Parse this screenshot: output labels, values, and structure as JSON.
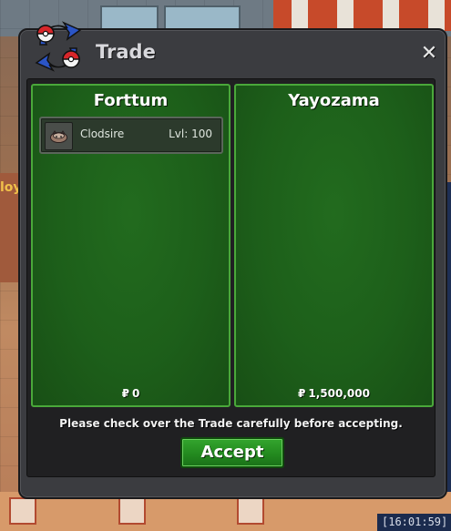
{
  "window": {
    "title": "Trade",
    "close_icon": "close-icon",
    "trade_icon": "pokeball-swap-icon"
  },
  "left_panel": {
    "player": "Forttum",
    "items": [
      {
        "name": "Clodsire",
        "level": "Lvl: 100",
        "icon": "pokemon-sprite-icon"
      }
    ],
    "money_symbol": "₽",
    "money": "0"
  },
  "right_panel": {
    "player": "Yayozama",
    "items": [],
    "money_symbol": "₽",
    "money": "1,500,000"
  },
  "notice": "Please check over the Trade carefully before accepting.",
  "accept_label": "Accept",
  "background": {
    "left_name_fragment": "loy",
    "timestamp": "[16:01:59] ["
  },
  "colors": {
    "panel_green": "#1d5f1a",
    "panel_border": "#4aa83a",
    "accept_green": "#238a1f",
    "window_bg": "#3b3c40"
  }
}
